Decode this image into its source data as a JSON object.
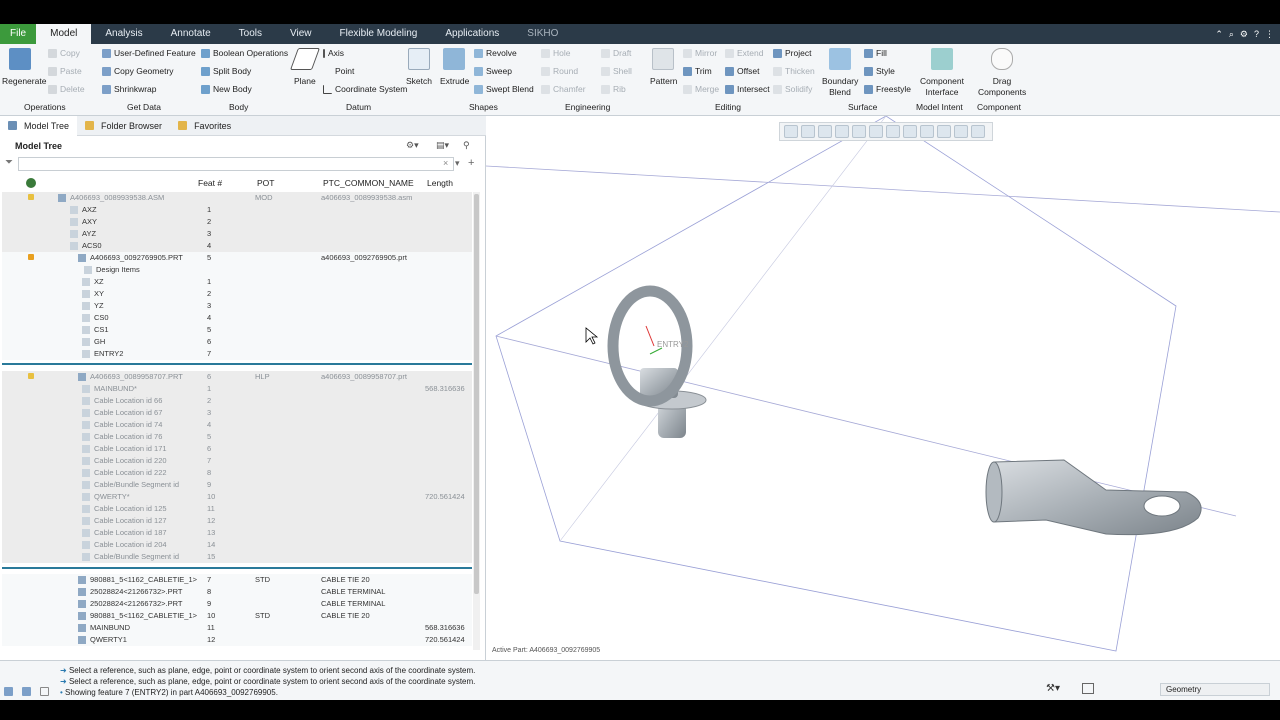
{
  "menubar": {
    "tabs": [
      "File",
      "Model",
      "Analysis",
      "Annotate",
      "Tools",
      "View",
      "Flexible Modeling",
      "Applications",
      "SIKHO"
    ]
  },
  "ribbon": {
    "operations": {
      "regenerate": "Regenerate",
      "copy": "Copy",
      "paste": "Paste",
      "delete": "Delete",
      "group": "Operations"
    },
    "get_data": {
      "udf": "User-Defined Feature",
      "copy_geom": "Copy Geometry",
      "shrinkwrap": "Shrinkwrap",
      "group": "Get Data"
    },
    "body": {
      "boolean": "Boolean Operations",
      "split": "Split Body",
      "new": "New Body",
      "group": "Body"
    },
    "datum": {
      "plane": "Plane",
      "axis": "Axis",
      "point": "Point",
      "csys": "Coordinate System",
      "sketch": "Sketch",
      "group": "Datum"
    },
    "shapes": {
      "extrude": "Extrude",
      "revolve": "Revolve",
      "sweep": "Sweep",
      "swept_blend": "Swept Blend",
      "group": "Shapes"
    },
    "engineering": {
      "hole": "Hole",
      "round": "Round",
      "chamfer": "Chamfer",
      "draft": "Draft",
      "shell": "Shell",
      "rib": "Rib",
      "group": "Engineering"
    },
    "editing": {
      "pattern": "Pattern",
      "mirror": "Mirror",
      "trim": "Trim",
      "merge": "Merge",
      "extend": "Extend",
      "offset": "Offset",
      "intersect": "Intersect",
      "project": "Project",
      "thicken": "Thicken",
      "solidify": "Solidify",
      "group": "Editing"
    },
    "surface": {
      "boundary_1": "Boundary",
      "boundary_2": "Blend",
      "fill": "Fill",
      "style": "Style",
      "freestyle": "Freestyle",
      "group": "Surface"
    },
    "model_intent": {
      "ci_1": "Component",
      "ci_2": "Interface",
      "group": "Model Intent"
    },
    "component": {
      "drag_1": "Drag",
      "drag_2": "Components",
      "group": "Component"
    }
  },
  "nav_tabs": {
    "model_tree": "Model Tree",
    "folder_browser": "Folder Browser",
    "favorites": "Favorites"
  },
  "tree": {
    "title": "Model Tree",
    "columns": {
      "feat": "Feat #",
      "pot": "POT",
      "ptc": "PTC_COMMON_NAME",
      "length": "Length"
    },
    "rows": [
      {
        "name": "A406693_0089939538.ASM",
        "feat": "",
        "pot": "MOD",
        "ptc": "a406693_0089939538.asm",
        "len": ""
      },
      {
        "name": "AXZ",
        "feat": "1",
        "pot": "",
        "ptc": "",
        "len": ""
      },
      {
        "name": "AXY",
        "feat": "2",
        "pot": "",
        "ptc": "",
        "len": ""
      },
      {
        "name": "AYZ",
        "feat": "3",
        "pot": "",
        "ptc": "",
        "len": ""
      },
      {
        "name": "ACS0",
        "feat": "4",
        "pot": "",
        "ptc": "",
        "len": ""
      },
      {
        "name": "A406693_0092769905.PRT",
        "feat": "5",
        "pot": "",
        "ptc": "a406693_0092769905.prt",
        "len": ""
      },
      {
        "name": "Design Items",
        "feat": "",
        "pot": "",
        "ptc": "",
        "len": ""
      },
      {
        "name": "XZ",
        "feat": "1",
        "pot": "",
        "ptc": "",
        "len": ""
      },
      {
        "name": "XY",
        "feat": "2",
        "pot": "",
        "ptc": "",
        "len": ""
      },
      {
        "name": "YZ",
        "feat": "3",
        "pot": "",
        "ptc": "",
        "len": ""
      },
      {
        "name": "CS0",
        "feat": "4",
        "pot": "",
        "ptc": "",
        "len": ""
      },
      {
        "name": "CS1",
        "feat": "5",
        "pot": "",
        "ptc": "",
        "len": ""
      },
      {
        "name": "GH",
        "feat": "6",
        "pot": "",
        "ptc": "",
        "len": ""
      },
      {
        "name": "ENTRY2",
        "feat": "7",
        "pot": "",
        "ptc": "",
        "len": ""
      },
      {
        "name": "A406693_0089958707.PRT",
        "feat": "6",
        "pot": "HLP",
        "ptc": "a406693_0089958707.prt",
        "len": ""
      },
      {
        "name": "MAINBUND*",
        "feat": "1",
        "pot": "",
        "ptc": "",
        "len": "568.316636"
      },
      {
        "name": "Cable Location id 66",
        "feat": "2",
        "pot": "",
        "ptc": "",
        "len": ""
      },
      {
        "name": "Cable Location id 67",
        "feat": "3",
        "pot": "",
        "ptc": "",
        "len": ""
      },
      {
        "name": "Cable Location id 74",
        "feat": "4",
        "pot": "",
        "ptc": "",
        "len": ""
      },
      {
        "name": "Cable Location id 76",
        "feat": "5",
        "pot": "",
        "ptc": "",
        "len": ""
      },
      {
        "name": "Cable Location id 171",
        "feat": "6",
        "pot": "",
        "ptc": "",
        "len": ""
      },
      {
        "name": "Cable Location id 220",
        "feat": "7",
        "pot": "",
        "ptc": "",
        "len": ""
      },
      {
        "name": "Cable Location id 222",
        "feat": "8",
        "pot": "",
        "ptc": "",
        "len": ""
      },
      {
        "name": "Cable/Bundle Segment id",
        "feat": "9",
        "pot": "",
        "ptc": "",
        "len": ""
      },
      {
        "name": "QWERTY*",
        "feat": "10",
        "pot": "",
        "ptc": "",
        "len": "720.561424"
      },
      {
        "name": "Cable Location id 125",
        "feat": "11",
        "pot": "",
        "ptc": "",
        "len": ""
      },
      {
        "name": "Cable Location id 127",
        "feat": "12",
        "pot": "",
        "ptc": "",
        "len": ""
      },
      {
        "name": "Cable Location id 187",
        "feat": "13",
        "pot": "",
        "ptc": "",
        "len": ""
      },
      {
        "name": "Cable Location id 204",
        "feat": "14",
        "pot": "",
        "ptc": "",
        "len": ""
      },
      {
        "name": "Cable/Bundle Segment id",
        "feat": "15",
        "pot": "",
        "ptc": "",
        "len": ""
      },
      {
        "name": "980881_5<1162_CABLETIE_1>",
        "feat": "7",
        "pot": "STD",
        "ptc": "CABLE TIE 20",
        "len": ""
      },
      {
        "name": "25028824<21266732>.PRT",
        "feat": "8",
        "pot": "",
        "ptc": "CABLE TERMINAL",
        "len": ""
      },
      {
        "name": "25028824<21266732>.PRT",
        "feat": "9",
        "pot": "",
        "ptc": "CABLE TERMINAL",
        "len": ""
      },
      {
        "name": "980881_5<1162_CABLETIE_1>",
        "feat": "10",
        "pot": "STD",
        "ptc": "CABLE TIE 20",
        "len": ""
      },
      {
        "name": "MAINBUND",
        "feat": "11",
        "pot": "",
        "ptc": "",
        "len": "568.316636"
      },
      {
        "name": "QWERTY1",
        "feat": "12",
        "pot": "",
        "ptc": "",
        "len": "720.561424"
      }
    ]
  },
  "viewport": {
    "active_part": "Active Part: A406693_0092769905",
    "label_entry": "ENTRY2"
  },
  "status": {
    "messages": [
      "Select a reference, such as plane, edge, point or coordinate system to orient second axis of the coordinate system.",
      "Select a reference, such as plane, edge, point or coordinate system to orient second axis of the coordinate system.",
      "Showing feature 7 (ENTRY2) in part A406693_0092769905."
    ],
    "filter_value": "Geometry"
  },
  "colors": {
    "accent_green": "#3c9a3c",
    "menubar": "#2b3a48",
    "tree_sep": "#2a7a9a"
  }
}
